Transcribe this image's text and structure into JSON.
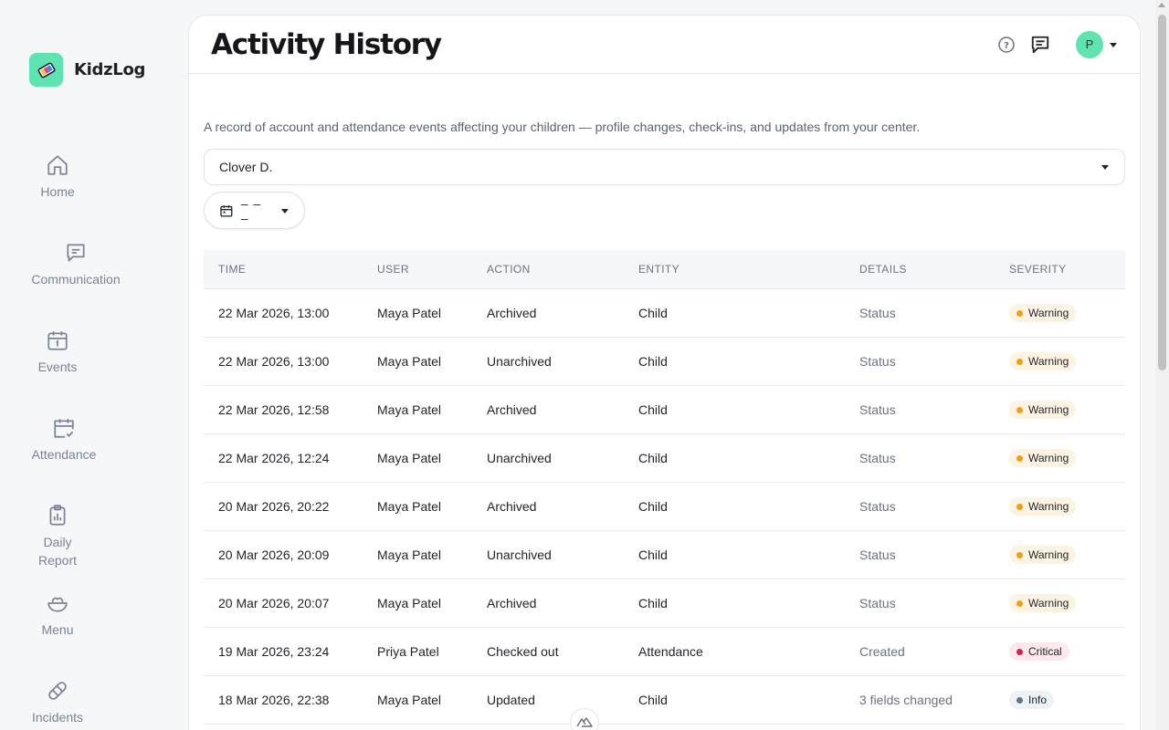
{
  "app": {
    "name": "KidzLog",
    "colors": {
      "brand": "#5ee3b1",
      "warning": "#f59e0b",
      "critical": "#e11d48",
      "info": "#64748b"
    }
  },
  "sidebar": {
    "items": [
      {
        "label": "Home",
        "icon": "home-icon"
      },
      {
        "label": "Communication",
        "icon": "chat-icon"
      },
      {
        "label": "Events",
        "icon": "calendar-icon"
      },
      {
        "label": "Attendance",
        "icon": "calendar-check-icon"
      },
      {
        "label": "Daily\nReport",
        "icon": "clipboard-icon"
      },
      {
        "label": "Menu",
        "icon": "bowl-icon"
      },
      {
        "label": "Incidents",
        "icon": "bandage-icon"
      }
    ]
  },
  "header": {
    "title": "Activity History",
    "avatar_initial": "P"
  },
  "main": {
    "description": "A record of account and attendance events affecting your children — profile changes, check-ins, and updates from your center.",
    "child_select": {
      "value": "Clover D."
    },
    "date_filter": {
      "value": "– – –"
    }
  },
  "table": {
    "columns": [
      "TIME",
      "USER",
      "ACTION",
      "ENTITY",
      "DETAILS",
      "SEVERITY"
    ],
    "rows": [
      {
        "time": "22 Mar 2026, 13:00",
        "user": "Maya Patel",
        "action": "Archived",
        "entity": "Child",
        "details": "Status",
        "severity": "Warning"
      },
      {
        "time": "22 Mar 2026, 13:00",
        "user": "Maya Patel",
        "action": "Unarchived",
        "entity": "Child",
        "details": "Status",
        "severity": "Warning"
      },
      {
        "time": "22 Mar 2026, 12:58",
        "user": "Maya Patel",
        "action": "Archived",
        "entity": "Child",
        "details": "Status",
        "severity": "Warning"
      },
      {
        "time": "22 Mar 2026, 12:24",
        "user": "Maya Patel",
        "action": "Unarchived",
        "entity": "Child",
        "details": "Status",
        "severity": "Warning"
      },
      {
        "time": "20 Mar 2026, 20:22",
        "user": "Maya Patel",
        "action": "Archived",
        "entity": "Child",
        "details": "Status",
        "severity": "Warning"
      },
      {
        "time": "20 Mar 2026, 20:09",
        "user": "Maya Patel",
        "action": "Unarchived",
        "entity": "Child",
        "details": "Status",
        "severity": "Warning"
      },
      {
        "time": "20 Mar 2026, 20:07",
        "user": "Maya Patel",
        "action": "Archived",
        "entity": "Child",
        "details": "Status",
        "severity": "Warning"
      },
      {
        "time": "19 Mar 2026, 23:24",
        "user": "Priya Patel",
        "action": "Checked out",
        "entity": "Attendance",
        "details": "Created",
        "severity": "Critical"
      },
      {
        "time": "18 Mar 2026, 22:38",
        "user": "Maya Patel",
        "action": "Updated",
        "entity": "Child",
        "details": "3 fields changed",
        "severity": "Info"
      }
    ]
  }
}
